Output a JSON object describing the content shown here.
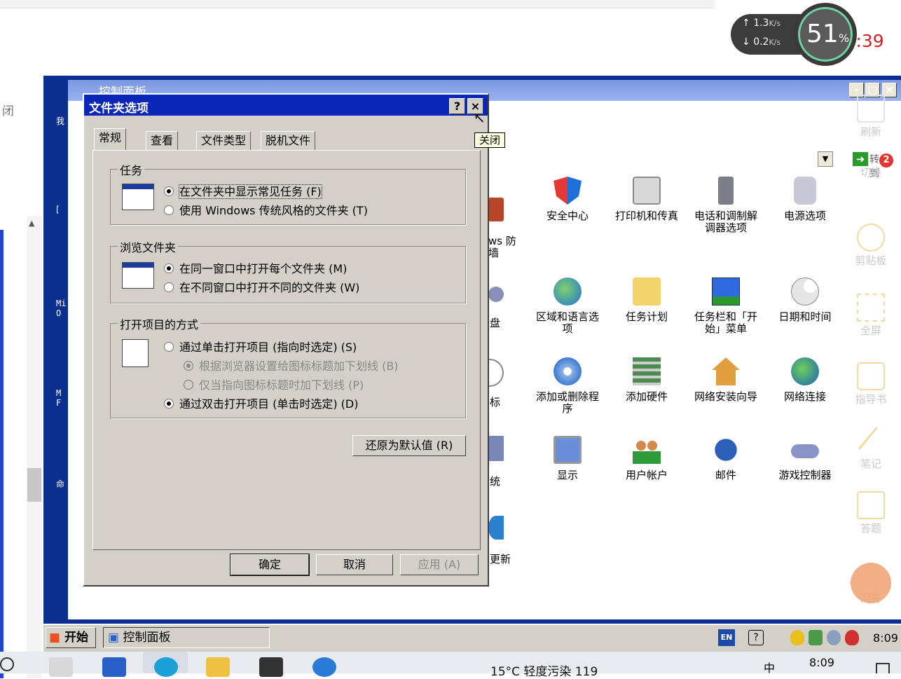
{
  "browser": {
    "close_fragment": "闭"
  },
  "net": {
    "up_value": "1.3",
    "down_value": "0.2",
    "unit": "K/s",
    "percent": "51",
    "percent_unit": "%",
    "clock_fragment": "00:4?:39"
  },
  "side": {
    "labels": [
      "我",
      "[",
      "Mi\nO",
      "M\nF",
      "命"
    ]
  },
  "control_panel": {
    "title": "控制面板",
    "go_label": "转到",
    "badge": "2",
    "items_row1": [
      "安全中心",
      "打印机和传真",
      "电话和调制解调器选项",
      "电源选项"
    ],
    "items_row2": [
      "区域和语言选项",
      "任务计划",
      "任务栏和「开始」菜单",
      "日期和时间"
    ],
    "items_row3": [
      "添加或删除程序",
      "添加硬件",
      "网络安装向导",
      "网络连接"
    ],
    "items_row4": [
      "显示",
      "用户帐户",
      "邮件",
      "游戏控制器"
    ],
    "partial": [
      "ws 防\n墙",
      "盘",
      "标",
      "统",
      "更新"
    ]
  },
  "tools": [
    "刷新",
    "切换",
    "剪贴板",
    "全屏",
    "指导书",
    "笔记",
    "答题",
    "问答"
  ],
  "dialog": {
    "title": "文件夹选项",
    "help_label": "?",
    "close_label": "×",
    "tooltip": "关闭",
    "tabs": [
      "常规",
      "查看",
      "文件类型",
      "脱机文件"
    ],
    "group1": {
      "label": "任务",
      "opt1": "在文件夹中显示常见任务 (F)",
      "opt2": "使用 Windows 传统风格的文件夹 (T)"
    },
    "group2": {
      "label": "浏览文件夹",
      "opt1": "在同一窗口中打开每个文件夹 (M)",
      "opt2": "在不同窗口中打开不同的文件夹 (W)"
    },
    "group3": {
      "label": "打开项目的方式",
      "opt1": "通过单击打开项目 (指向时选定) (S)",
      "sub1": "根据浏览器设置给图标标题加下划线 (B)",
      "sub2": "仅当指向图标标题时加下划线 (P)",
      "opt2": "通过双击打开项目 (单击时选定) (D)"
    },
    "restore_label": "还原为默认值 (R)",
    "ok_label": "确定",
    "cancel_label": "取消",
    "apply_label": "应用 (A)"
  },
  "xp_taskbar": {
    "start_label": "开始",
    "task_label": "控制面板",
    "lang": "EN",
    "help": "?",
    "time": "8:09"
  },
  "win_taskbar": {
    "weather": "15°C 轻度污染 119",
    "time": "8:09",
    "ime": "中"
  }
}
